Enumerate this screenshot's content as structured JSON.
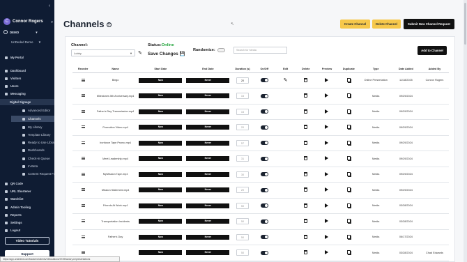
{
  "sidebar": {
    "user_name": "Connor Rogers",
    "user_initial": "C",
    "org": "DEMO",
    "sub_org": "UnDeded Demo",
    "items": [
      {
        "label": "My Portal",
        "top": 0
      },
      {
        "label": "Dashboard"
      },
      {
        "label": "Visitors"
      },
      {
        "label": "Users"
      },
      {
        "label": "Messaging"
      },
      {
        "label": "Digital Signage"
      },
      {
        "label": "Advanced Editor"
      },
      {
        "label": "Channels"
      },
      {
        "label": "My Library"
      },
      {
        "label": "Template Library"
      },
      {
        "label": "Ready to Use Library"
      },
      {
        "label": "Dashboards"
      },
      {
        "label": "Check-in Queue"
      },
      {
        "label": "In-Beta"
      },
      {
        "label": "Content Request Form"
      },
      {
        "label": "QR Code"
      },
      {
        "label": "URL Shortener"
      },
      {
        "label": "Watchlist"
      },
      {
        "label": "Admin Tooling"
      },
      {
        "label": "Reports"
      },
      {
        "label": "Settings"
      },
      {
        "label": "Logout"
      }
    ],
    "video_tutorials": "Video Tutorials",
    "support": "Support"
  },
  "status_url": "https://app.undeded.com/backend/clients/15/locations/3749/factory-in/presentations",
  "header": {
    "title": "Channels",
    "help_icon": "?",
    "create_channel": "Create Channel",
    "delete_channel": "Delete Channel",
    "submit_request": "Submit New Channel Request"
  },
  "controls": {
    "channel_label": "Channel:",
    "channel_value": "Lobby",
    "status_label": "Status:",
    "status_value": "Online",
    "save_changes": "Save Changes",
    "randomize_label": "Randomize:",
    "search_placeholder": "Search for Media",
    "add_to_channel": "Add to Channel"
  },
  "table": {
    "columns": [
      "Reorder",
      "Name",
      "Start Date",
      "End Date",
      "Duration (s)",
      "On/Off",
      "Edit",
      "Delete",
      "Preview",
      "Duplicate",
      "Type",
      "Date Added",
      "Added By"
    ],
    "rows": [
      {
        "name": "Bingo",
        "start": "Now",
        "end": "Never",
        "duration": "20",
        "type": "Online Presentation",
        "date": "11/18/2025",
        "by": "Connor Rogers",
        "edit": true,
        "dur_active": true
      },
      {
        "name": "Milestones 5th Anniversary.mp4",
        "start": "Now",
        "end": "Never",
        "duration": "15",
        "type": "Media",
        "date": "09/29/2024",
        "by": ""
      },
      {
        "name": "Father's Day Transmission.mp4",
        "start": "Now",
        "end": "Never",
        "duration": "15",
        "type": "Media",
        "date": "09/29/2024",
        "by": ""
      },
      {
        "name": "Promotion Video.mp4",
        "start": "Now",
        "end": "Never",
        "duration": "20",
        "type": "Media",
        "date": "09/29/2024",
        "by": ""
      },
      {
        "name": "Ironforce Tape Promo.mp4",
        "start": "Now",
        "end": "Never",
        "duration": "57",
        "type": "Media",
        "date": "09/29/2024",
        "by": ""
      },
      {
        "name": "Meet Leadership.mp4",
        "start": "Now",
        "end": "Never",
        "duration": "31",
        "type": "Media",
        "date": "09/29/2024",
        "by": ""
      },
      {
        "name": "MyMission Tape.mp4",
        "start": "Now",
        "end": "Never",
        "duration": "30",
        "type": "Media",
        "date": "09/29/2024",
        "by": ""
      },
      {
        "name": "Mission Statement.mp4",
        "start": "Now",
        "end": "Never",
        "duration": "20",
        "type": "Media",
        "date": "09/29/2024",
        "by": ""
      },
      {
        "name": "Friends At Work.mp4",
        "start": "Now",
        "end": "Never",
        "duration": "50",
        "type": "Media",
        "date": "03/28/2024",
        "by": ""
      },
      {
        "name": "Transportation Incidents",
        "start": "Now",
        "end": "Never",
        "duration": "50",
        "type": "Media",
        "date": "03/28/2024",
        "by": ""
      },
      {
        "name": "Father's Day",
        "start": "Now",
        "end": "Never",
        "duration": "50",
        "type": "Media",
        "date": "06/17/2024",
        "by": ""
      },
      {
        "name": "",
        "start": "Now",
        "end": "Never",
        "duration": "50",
        "type": "Media",
        "date": "03/28/2024",
        "by": "Chad Edwards"
      }
    ]
  }
}
